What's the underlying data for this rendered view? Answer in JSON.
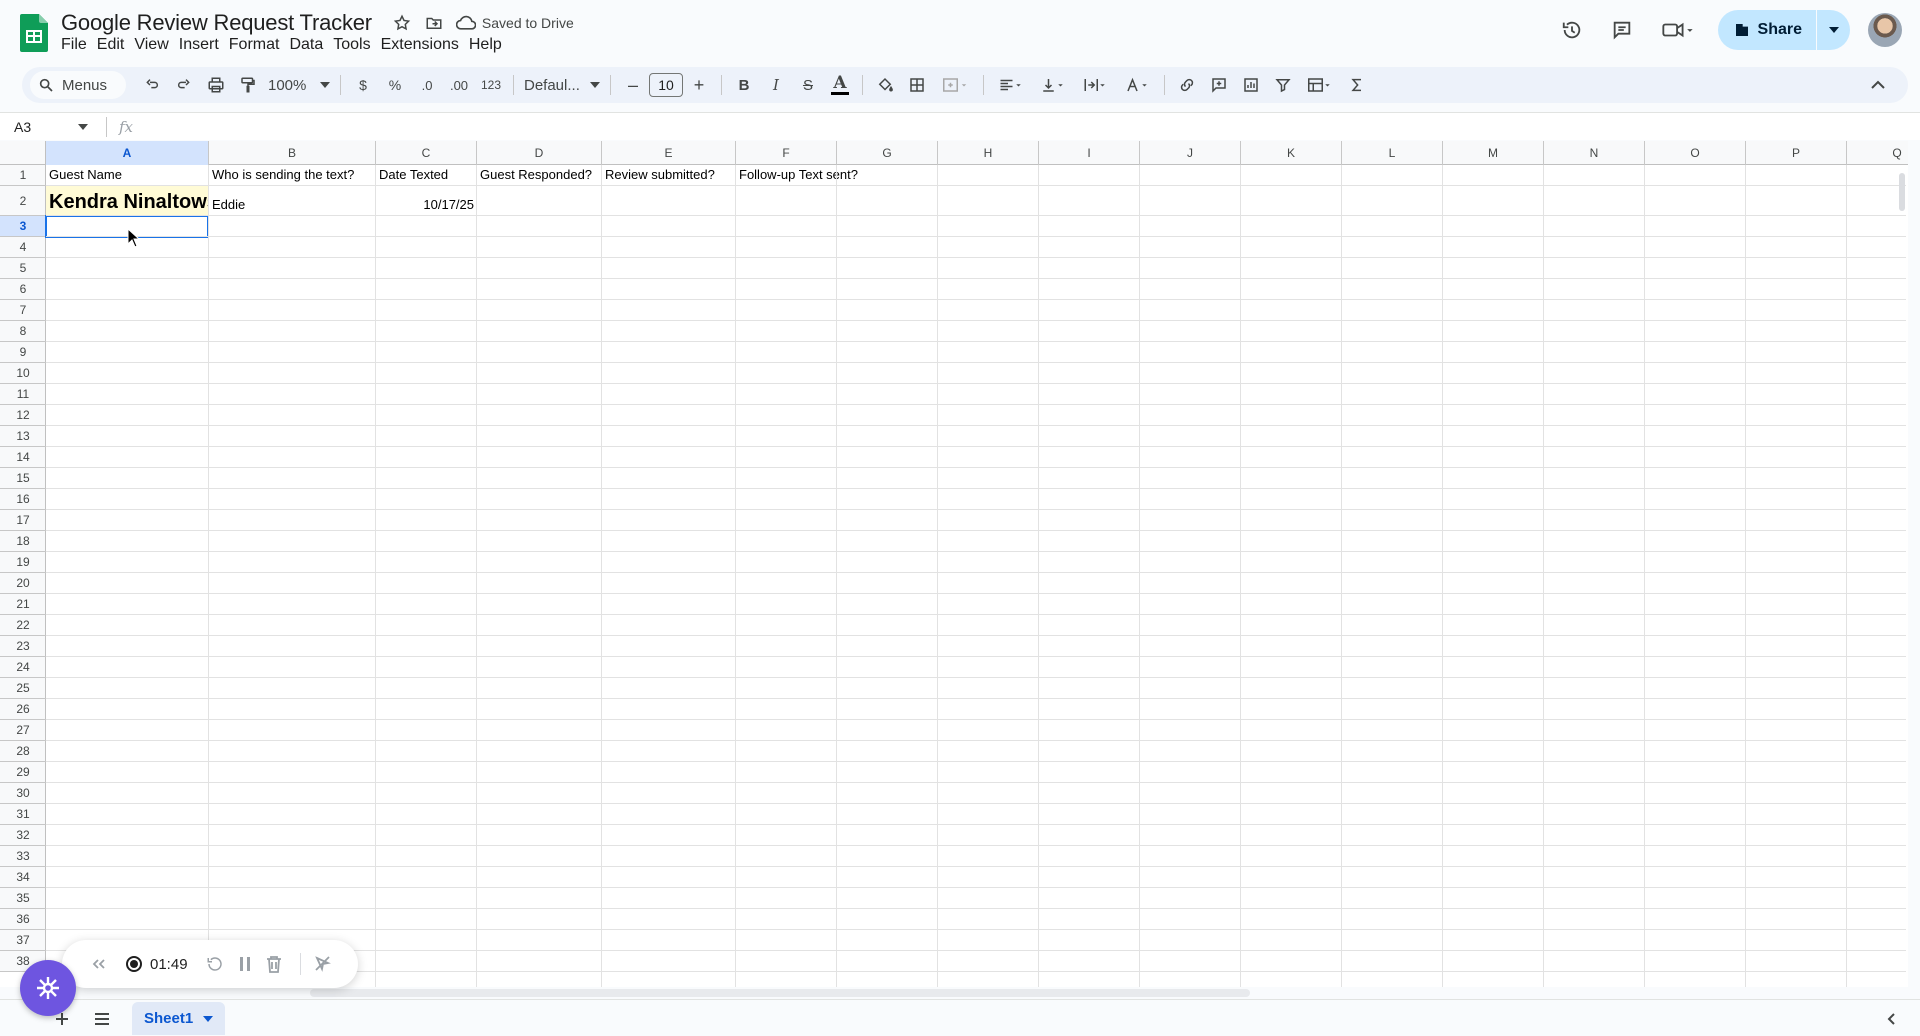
{
  "app": {
    "title": "Google Review Request Tracker",
    "saved_status": "Saved to Drive",
    "share_label": "Share",
    "accent": "#0b57d0"
  },
  "menubar": [
    "File",
    "Edit",
    "View",
    "Insert",
    "Format",
    "Data",
    "Tools",
    "Extensions",
    "Help"
  ],
  "toolbar": {
    "menus_label": "Menus",
    "zoom": "100%",
    "currency": "$",
    "percent": "%",
    "dec_decrease": ".0",
    "dec_increase": ".00",
    "number_format": "123",
    "font": "Defaul...",
    "font_size": "10",
    "minus": "–",
    "plus": "+",
    "bold": "B",
    "italic": "I",
    "strike": "S",
    "text_color": "A"
  },
  "formula_bar": {
    "cell_ref": "A3",
    "fx": "fx",
    "value": ""
  },
  "grid": {
    "columns": [
      "A",
      "B",
      "C",
      "D",
      "E",
      "F",
      "G",
      "H",
      "I",
      "J",
      "K",
      "L",
      "M",
      "N",
      "O",
      "P",
      "Q"
    ],
    "selected_column": "A",
    "selected_row": 3,
    "rows": [
      "1",
      "2",
      "3",
      "4",
      "5",
      "6",
      "7",
      "8",
      "9",
      "10",
      "11",
      "12",
      "13",
      "14",
      "15",
      "16",
      "17",
      "18",
      "19",
      "20",
      "21",
      "22",
      "23",
      "24",
      "25",
      "26",
      "27",
      "28",
      "29",
      "30",
      "31",
      "32",
      "33",
      "34",
      "35",
      "36",
      "37",
      "38"
    ],
    "headers": [
      "Guest Name",
      "Who is sending the text?",
      "Date Texted",
      "Guest Responded?",
      "Review submitted?",
      "Follow-up Text sent?"
    ],
    "row2": {
      "guest_name": "Kendra Ninaltowski",
      "sender": "Eddie",
      "date_texted": "10/17/25"
    }
  },
  "sheets": {
    "active": "Sheet1"
  },
  "recorder": {
    "time": "01:49"
  }
}
